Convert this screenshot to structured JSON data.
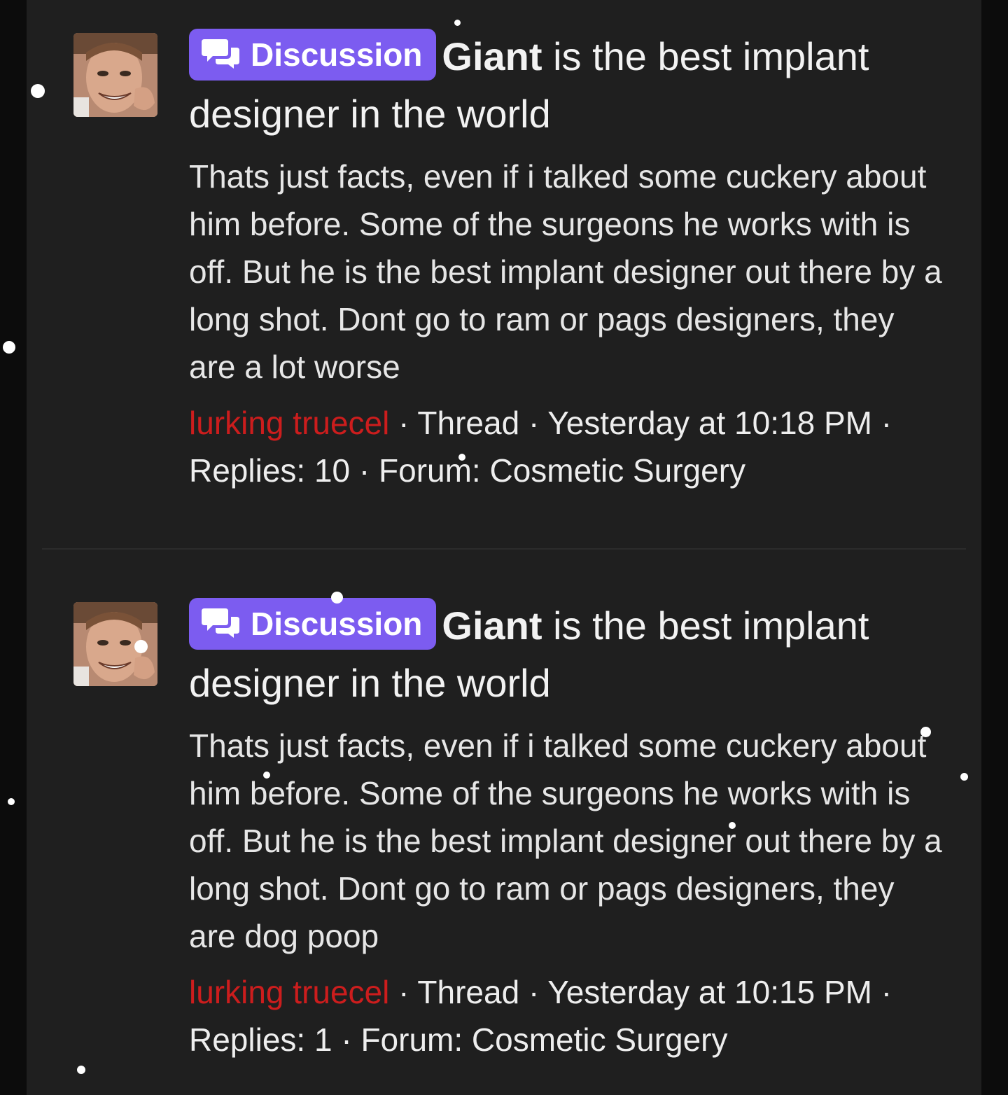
{
  "colors": {
    "page_bg": "#0c0c0c",
    "panel_bg": "#1f1f1f",
    "label_bg": "#7c5cf0",
    "author": "#cc1d1d",
    "text": "#e6e6e6"
  },
  "results": [
    {
      "label": "Discussion",
      "label_icon": "chat-bubbles-icon",
      "title_strong": "Giant",
      "title_rest": " is the best implant designer in the world",
      "snippet": "Thats just facts, even if i talked some cuckery about him before. Some of the surgeons he works with is off. But he is the best implant designer out there by a long shot. Dont go to ram or pags designers, they are a lot worse",
      "author": "lurking truecel",
      "type": "Thread",
      "time": "Yesterday at 10:18 PM",
      "replies": "Replies: 10",
      "forum": "Forum: Cosmetic Surgery"
    },
    {
      "label": "Discussion",
      "label_icon": "chat-bubbles-icon",
      "title_strong": "Giant",
      "title_rest": " is the best implant designer in the world",
      "snippet": "Thats just facts, even if i talked some cuckery about him before. Some of the surgeons he works with is off. But he is the best implant designer out there by a long shot. Dont go to ram or pags designers, they are dog poop",
      "author": "lurking truecel",
      "type": "Thread",
      "time": "Yesterday at 10:15 PM",
      "replies": "Replies: 1",
      "forum": "Forum: Cosmetic Surgery"
    }
  ],
  "separator": " · "
}
